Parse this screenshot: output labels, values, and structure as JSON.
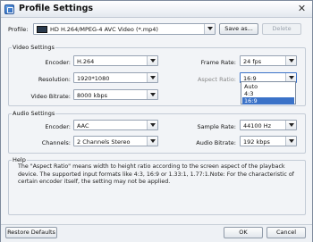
{
  "window": {
    "title": "Profile Settings",
    "close_glyph": "✕"
  },
  "profile": {
    "label": "Profile:",
    "value": "HD H.264/MPEG-4 AVC Video (*.mp4)",
    "save_as": "Save as...",
    "delete": "Delete"
  },
  "video": {
    "title": "Video Settings",
    "encoder_label": "Encoder:",
    "encoder": "H.264",
    "resolution_label": "Resolution:",
    "resolution": "1920*1080",
    "bitrate_label": "Video Bitrate:",
    "bitrate": "8000 kbps",
    "framerate_label": "Frame Rate:",
    "framerate": "24 fps",
    "aspect_label": "Aspect Ratio:",
    "aspect": "16:9",
    "aspect_options": [
      "Auto",
      "4:3",
      "16:9"
    ],
    "aspect_selected_index": 2
  },
  "audio": {
    "title": "Audio Settings",
    "encoder_label": "Encoder:",
    "encoder": "AAC",
    "channels_label": "Channels:",
    "channels": "2 Channels Stereo",
    "samplerate_label": "Sample Rate:",
    "samplerate": "44100 Hz",
    "bitrate_label": "Audio Bitrate:",
    "bitrate": "192 kbps"
  },
  "help": {
    "title": "Help",
    "text": "The \"Aspect Ratio\" means width to height ratio according to the screen aspect of the playback device. The supported input formats like 4:3, 16:9 or 1.33:1, 1.77:1.Note: For the characteristic of certain encoder itself, the setting may not be applied."
  },
  "footer": {
    "restore": "Restore Defaults",
    "ok": "OK",
    "cancel": "Cancel"
  }
}
